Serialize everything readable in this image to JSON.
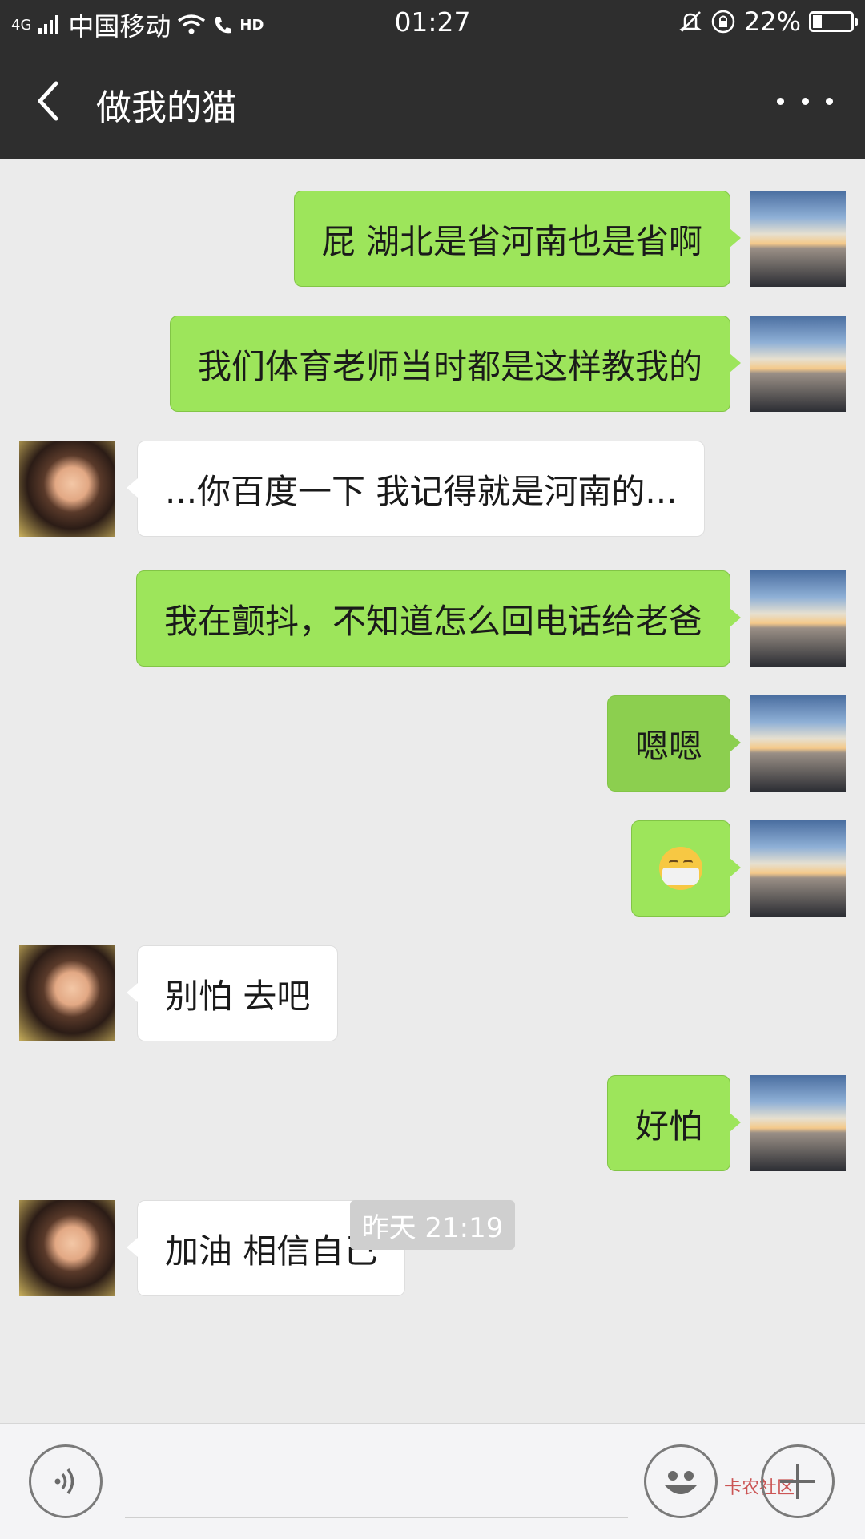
{
  "status_bar": {
    "network": "4G",
    "carrier": "中国移动",
    "hd_label": "HD",
    "time": "01:27",
    "battery_percent": "22%",
    "battery_level": 0.22
  },
  "header": {
    "title": "做我的猫"
  },
  "messages": [
    {
      "side": "me",
      "text": "屁  湖北是省河南也是省啊"
    },
    {
      "side": "me",
      "text": "我们体育老师当时都是这样教我的"
    },
    {
      "side": "her",
      "text": "...你百度一下 我记得就是河南的..."
    },
    {
      "side": "me",
      "text": "我在颤抖，不知道怎么回电话给老爸"
    },
    {
      "side": "me",
      "text": "嗯嗯"
    },
    {
      "side": "me",
      "emoji": "mask-face-emoji"
    },
    {
      "side": "her",
      "text": "别怕  去吧"
    },
    {
      "side": "me",
      "text": "好怕"
    },
    {
      "side": "her",
      "text": "加油 相信自己"
    }
  ],
  "timestamp": "昨天 21:19",
  "input_bar": {
    "placeholder": "",
    "voice_icon": "voice-icon",
    "emoji_icon": "emoji-icon",
    "plus_icon": "plus-icon",
    "watermark": "卡农社区"
  }
}
